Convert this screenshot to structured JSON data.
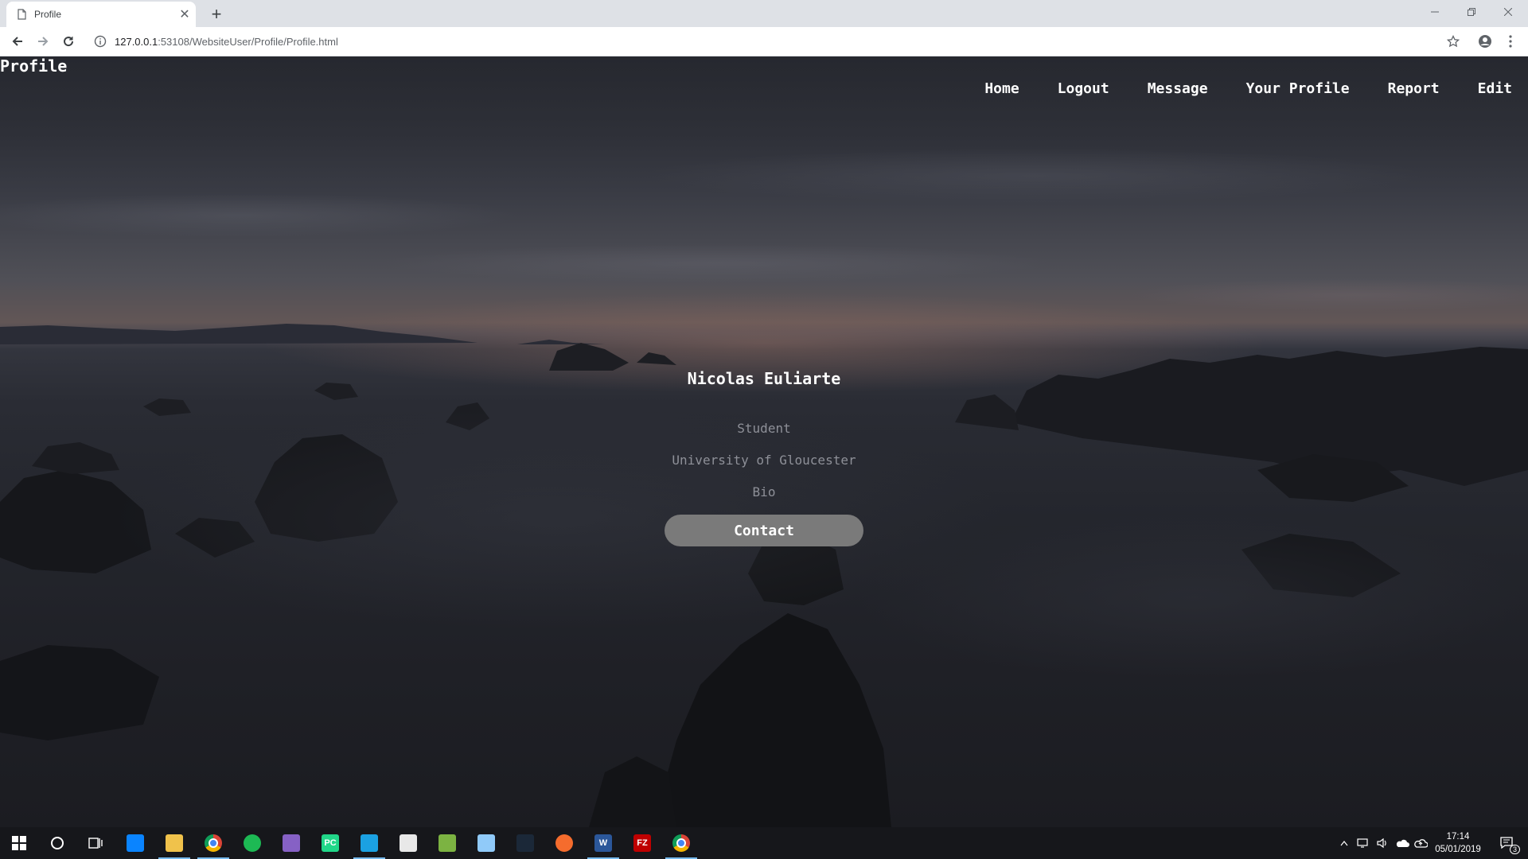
{
  "browser": {
    "tab_title": "Profile",
    "url_host": "127.0.0.1",
    "url_path": ":53108/WebsiteUser/Profile/Profile.html"
  },
  "page": {
    "brand": "Profile",
    "nav": [
      "Home",
      "Logout",
      "Message",
      "Your Profile",
      "Report",
      "Edit"
    ],
    "profile": {
      "name": "Nicolas Euliarte",
      "role": "Student",
      "institution": "University of Gloucester",
      "bio": "Bio",
      "contact_label": "Contact"
    }
  },
  "taskbar": {
    "apps": [
      {
        "icon": "onedrive-app-icon",
        "label": "",
        "color": "#0a84ff"
      },
      {
        "icon": "file-explorer-icon",
        "label": "",
        "color": "#f0c24b"
      },
      {
        "icon": "chrome-icon",
        "label": "",
        "color": "#db4437"
      },
      {
        "icon": "spotify-icon",
        "label": "",
        "color": "#1db954"
      },
      {
        "icon": "visual-studio-icon",
        "label": "",
        "color": "#8661c5"
      },
      {
        "icon": "pycharm-icon",
        "label": "PC",
        "color": "#21d789"
      },
      {
        "icon": "notepad-app-icon",
        "label": "",
        "color": "#1ba1e2"
      },
      {
        "icon": "document-app-icon",
        "label": "",
        "color": "#e8e8e8"
      },
      {
        "icon": "spreadsheet-app-icon",
        "label": "",
        "color": "#7cb342"
      },
      {
        "icon": "notes-app-icon",
        "label": "",
        "color": "#90caf9"
      },
      {
        "icon": "steam-icon",
        "label": "",
        "color": "#1b2838"
      },
      {
        "icon": "origin-icon",
        "label": "",
        "color": "#f56c2d"
      },
      {
        "icon": "word-icon",
        "label": "W",
        "color": "#2b579a"
      },
      {
        "icon": "filezilla-icon",
        "label": "FZ",
        "color": "#bf0000"
      },
      {
        "icon": "chrome-icon",
        "label": "",
        "color": "#db4437"
      }
    ],
    "time": "17:14",
    "date": "05/01/2019",
    "notification_count": "3"
  }
}
